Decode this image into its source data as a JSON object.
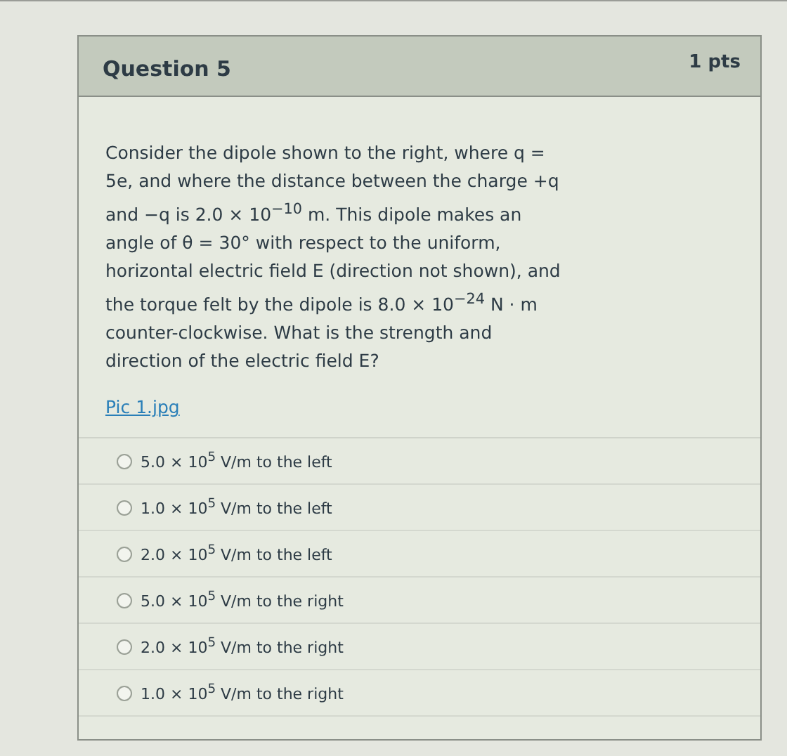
{
  "question": {
    "title": "Question 5",
    "points": "1 pts",
    "text": "Consider the dipole shown to the right, where q = 5e, and where the distance between the charge +q and −q is 2.0 × 10$^{−10}$ m. This dipole makes an angle of θ = 30° with respect to the uniform, horizontal electric field E (direction not shown), and the torque felt by the dipole is 8.0 × 10$^{−24}$ N · m counter-clockwise. What is the strength and direction of the electric field E?",
    "attachment": "Pic 1.jpg",
    "options": [
      {
        "text": "5.0 × 10$^{5}$ V/m to the left",
        "selected": false
      },
      {
        "text": "1.0 × 10$^{5}$ V/m to the left",
        "selected": false
      },
      {
        "text": "2.0 × 10$^{5}$ V/m to the left",
        "selected": false
      },
      {
        "text": "5.0 × 10$^{5}$ V/m to the right",
        "selected": false
      },
      {
        "text": "2.0 × 10$^{5}$ V/m to the right",
        "selected": false
      },
      {
        "text": "1.0 × 10$^{5}$ V/m to the right",
        "selected": false
      }
    ]
  }
}
